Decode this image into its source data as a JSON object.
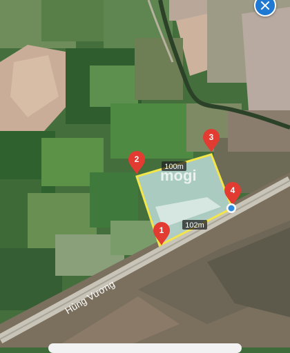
{
  "map": {
    "road_name": "Hùng Vương",
    "watermark": "mogi",
    "boundary_color": "#f2e64a",
    "marker_color": "#e23b32",
    "points": [
      {
        "id": "1",
        "label": "1"
      },
      {
        "id": "2",
        "label": "2"
      },
      {
        "id": "3",
        "label": "3"
      },
      {
        "id": "4",
        "label": "4"
      }
    ],
    "edges": [
      {
        "from": "2",
        "to": "3",
        "distance": "100m"
      },
      {
        "from": "1",
        "to": "4",
        "distance": "102m"
      }
    ]
  },
  "controls": {
    "corner_button_icon": "close-icon"
  }
}
